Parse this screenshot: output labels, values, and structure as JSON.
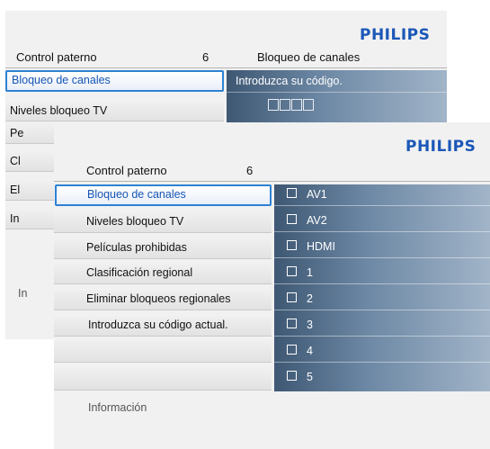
{
  "back_window": {
    "logo": "PHILIPS",
    "header_left": "Control paterno",
    "header_num": "6",
    "header_right": "Bloqueo de canales",
    "selected_item": "Bloqueo de canales",
    "second_item": "Niveles bloqueo TV",
    "partial_items": [
      "Pe",
      "Cl",
      "El",
      "In"
    ],
    "code_prompt": "Introduzca su código.",
    "info": "In"
  },
  "front_window": {
    "logo": "PHILIPS",
    "header_left": "Control paterno",
    "header_num": "6",
    "menu": [
      {
        "label": "Bloqueo de canales",
        "selected": true
      },
      {
        "label": "Niveles bloqueo TV",
        "selected": false
      },
      {
        "label": "Películas prohibidas",
        "selected": false
      },
      {
        "label": "Clasificación regional",
        "selected": false
      },
      {
        "label": "Eliminar bloqueos regionales",
        "selected": false
      },
      {
        "label": "Introduzca su código actual.",
        "selected": false
      },
      {
        "label": "",
        "selected": false
      },
      {
        "label": "",
        "selected": false
      }
    ],
    "channels": [
      "AV1",
      "AV2",
      "HDMI",
      "1",
      "2",
      "3",
      "4",
      "5"
    ],
    "info": "Información"
  },
  "colors": {
    "accent": "#2d82d3",
    "logo": "#1b57b8"
  }
}
